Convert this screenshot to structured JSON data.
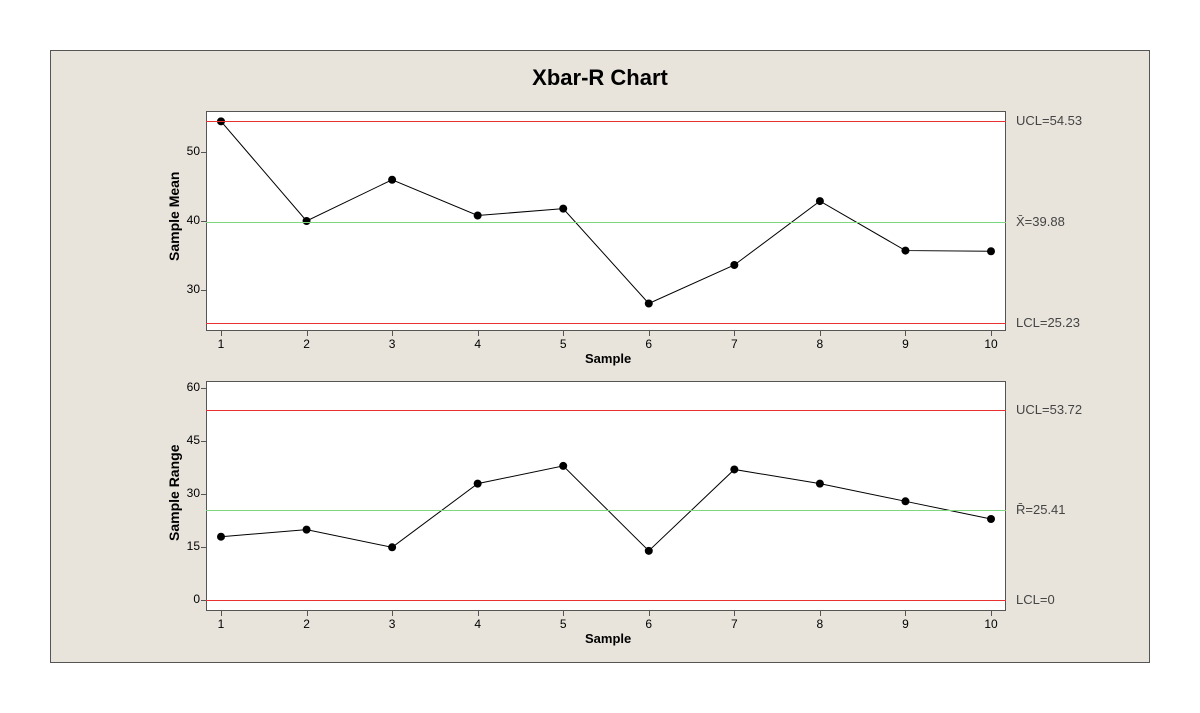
{
  "title": "Xbar-R Chart",
  "chart_data": [
    {
      "type": "line",
      "title": "Sample Mean",
      "xlabel": "Sample",
      "ylabel": "Sample Mean",
      "x": [
        1,
        2,
        3,
        4,
        5,
        6,
        7,
        8,
        9,
        10
      ],
      "values": [
        54.5,
        40.0,
        46.0,
        40.8,
        41.8,
        28.0,
        33.6,
        42.9,
        35.7,
        35.6
      ],
      "center": 39.88,
      "ucl": 54.53,
      "lcl": 25.23,
      "yticks": [
        30,
        40,
        50
      ],
      "ylim": [
        24,
        56
      ],
      "center_label": "X̄=39.88",
      "ucl_label": "UCL=54.53",
      "lcl_label": "LCL=25.23"
    },
    {
      "type": "line",
      "title": "Sample Range",
      "xlabel": "Sample",
      "ylabel": "Sample Range",
      "x": [
        1,
        2,
        3,
        4,
        5,
        6,
        7,
        8,
        9,
        10
      ],
      "values": [
        18,
        20,
        15,
        33,
        38,
        14,
        37,
        33,
        28,
        23
      ],
      "center": 25.41,
      "ucl": 53.72,
      "lcl": 0,
      "yticks": [
        0,
        15,
        30,
        45,
        60
      ],
      "ylim": [
        -3,
        62
      ],
      "center_label": "R̄=25.41",
      "ucl_label": "UCL=53.72",
      "lcl_label": "LCL=0"
    }
  ]
}
